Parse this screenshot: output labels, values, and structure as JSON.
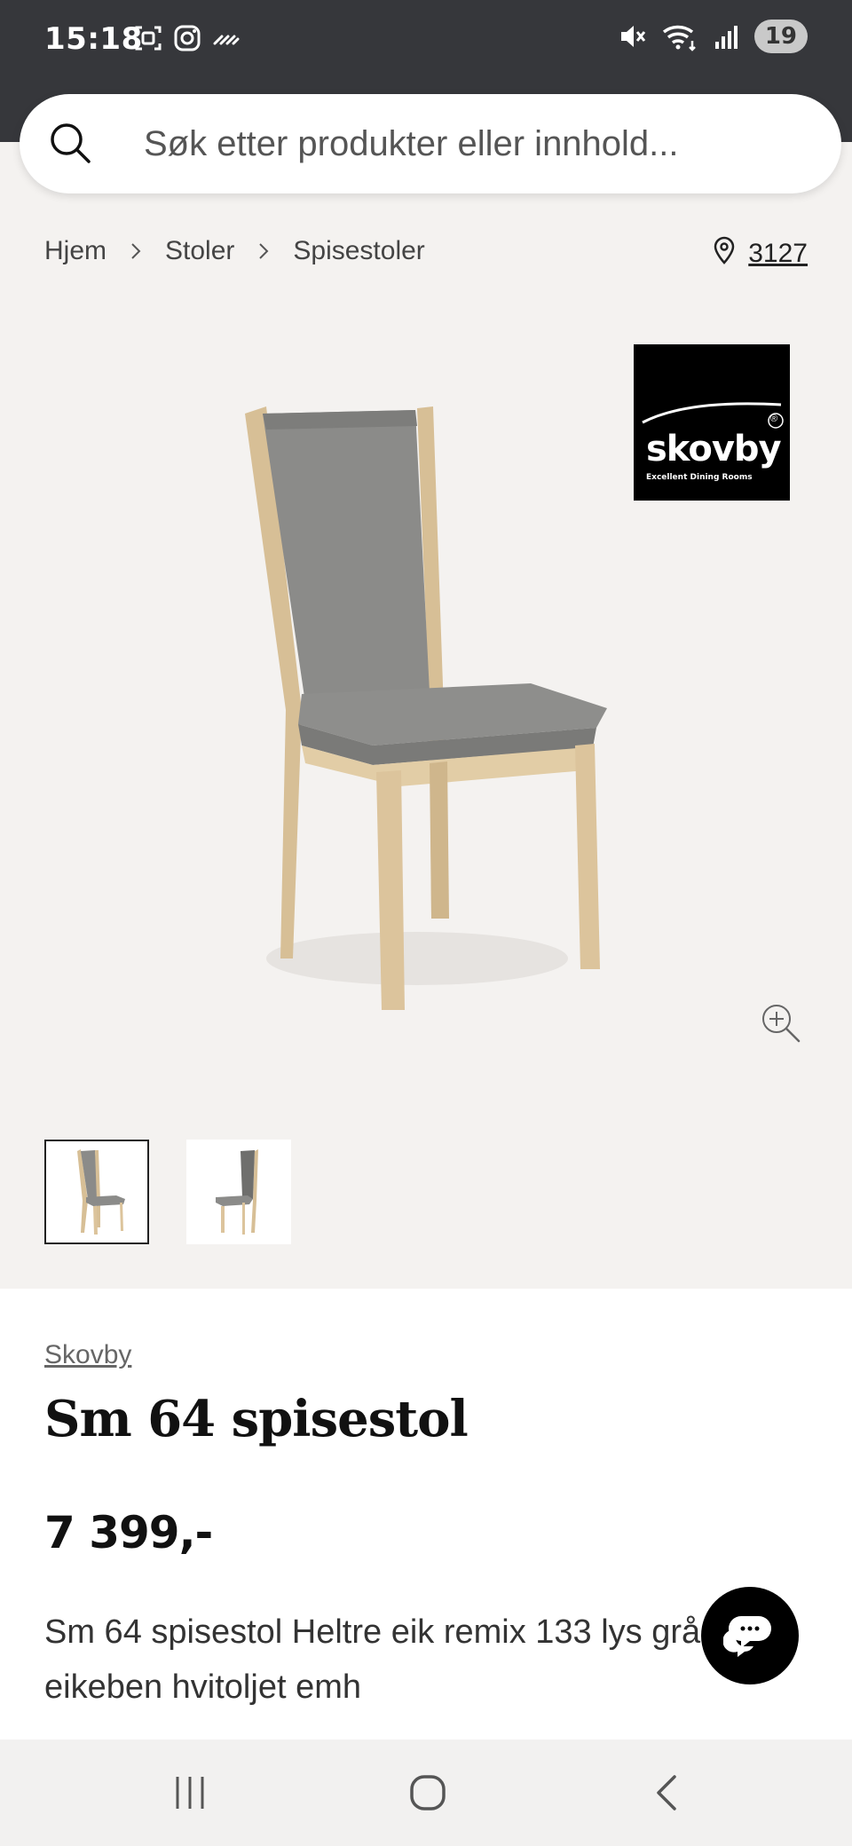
{
  "status_bar": {
    "time": "15:18",
    "battery": "19"
  },
  "search": {
    "placeholder": "Søk etter produkter eller innhold..."
  },
  "breadcrumb": {
    "items": [
      "Hjem",
      "Stoler",
      "Spisestoler"
    ]
  },
  "store": {
    "number": "3127"
  },
  "brand_logo": {
    "name": "skovby",
    "tagline": "Excellent Dining Rooms",
    "mark": "®"
  },
  "product": {
    "brand": "Skovby",
    "title": "Sm 64 spisestol",
    "price": "7 399,-",
    "description": "Sm 64 spisestol Heltre eik remix 133 lys grå med eikeben hvitoljet emh"
  },
  "thumbnails": {
    "count": 2,
    "active_index": 0
  },
  "colors": {
    "statusbar_bg": "#36373b",
    "page_bg": "#f4f2f0",
    "chat_button": "#000000",
    "upholstery": "#8a8a88",
    "wood": "#d9c29a"
  }
}
